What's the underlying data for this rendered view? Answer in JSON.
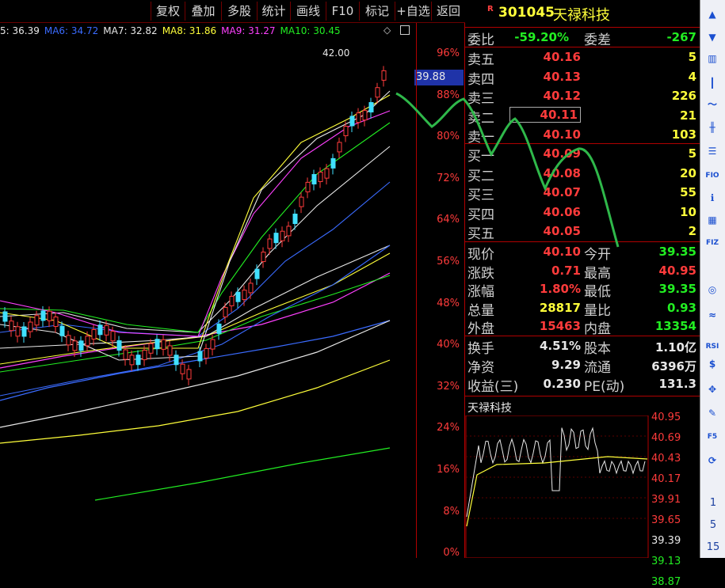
{
  "toolbar": {
    "buttons": [
      "复权",
      "叠加",
      "多股",
      "统计",
      "画线",
      "F10",
      "标记",
      "+自选",
      "返回"
    ]
  },
  "ma_legend": [
    {
      "label": "5: 36.39",
      "color": "#e8e8e8"
    },
    {
      "label": "MA6: 34.72",
      "color": "#3a6bff"
    },
    {
      "label": "MA7: 32.82",
      "color": "#e8e8e8"
    },
    {
      "label": "MA8: 31.86",
      "color": "#ffff3a"
    },
    {
      "label": "MA9: 31.27",
      "color": "#ff40ff"
    },
    {
      "label": "MA10: 30.45",
      "color": "#22ee22"
    }
  ],
  "main_chart": {
    "price_label": "39.88",
    "high_label": "42.00",
    "pct_axis": [
      "96%",
      "88%",
      "80%",
      "72%",
      "64%",
      "56%",
      "48%",
      "40%",
      "32%",
      "24%",
      "16%",
      "8%",
      "0%"
    ]
  },
  "quote": {
    "code": "301045",
    "name": "天禄科技",
    "r_marker": "R",
    "webi_label": "委比",
    "webi_value": "-59.20%",
    "wecha_label": "委差",
    "wecha_value": "-267",
    "asks": [
      {
        "label": "卖五",
        "price": "40.16",
        "vol": "5"
      },
      {
        "label": "卖四",
        "price": "40.13",
        "vol": "4"
      },
      {
        "label": "卖三",
        "price": "40.12",
        "vol": "226"
      },
      {
        "label": "卖二",
        "price": "40.11",
        "vol": "21"
      },
      {
        "label": "卖一",
        "price": "40.10",
        "vol": "103"
      }
    ],
    "bids": [
      {
        "label": "买一",
        "price": "40.09",
        "vol": "5"
      },
      {
        "label": "买二",
        "price": "40.08",
        "vol": "20"
      },
      {
        "label": "买三",
        "price": "40.07",
        "vol": "55"
      },
      {
        "label": "买四",
        "price": "40.06",
        "vol": "10"
      },
      {
        "label": "买五",
        "price": "40.05",
        "vol": "2"
      }
    ],
    "stats": [
      {
        "l1": "现价",
        "v1": "40.10",
        "c1": "red",
        "l2": "今开",
        "v2": "39.35",
        "c2": "green"
      },
      {
        "l1": "涨跌",
        "v1": "0.71",
        "c1": "red",
        "l2": "最高",
        "v2": "40.95",
        "c2": "red"
      },
      {
        "l1": "涨幅",
        "v1": "1.80%",
        "c1": "red",
        "l2": "最低",
        "v2": "39.35",
        "c2": "green"
      },
      {
        "l1": "总量",
        "v1": "28817",
        "c1": "yellow",
        "l2": "量比",
        "v2": "0.93",
        "c2": "green"
      },
      {
        "l1": "外盘",
        "v1": "15463",
        "c1": "red",
        "l2": "内盘",
        "v2": "13354",
        "c2": "green"
      }
    ],
    "fundamentals": [
      {
        "l1": "换手",
        "v1": "4.51%",
        "l2": "股本",
        "v2": "1.10亿"
      },
      {
        "l1": "净资",
        "v1": "9.29",
        "l2": "流通",
        "v2": "6396万"
      },
      {
        "l1": "收益(三)",
        "v1": "0.230",
        "l2": "PE(动)",
        "v2": "131.3"
      }
    ]
  },
  "mini_chart": {
    "title": "天禄科技",
    "ticks": [
      {
        "v": "40.95",
        "c": "red"
      },
      {
        "v": "40.69",
        "c": "red"
      },
      {
        "v": "40.43",
        "c": "red"
      },
      {
        "v": "40.17",
        "c": "red"
      },
      {
        "v": "39.91",
        "c": "red"
      },
      {
        "v": "39.65",
        "c": "red"
      },
      {
        "v": "39.39",
        "c": "white"
      },
      {
        "v": "39.13",
        "c": "green"
      },
      {
        "v": "38.87",
        "c": "green"
      }
    ]
  },
  "sidebar": {
    "icons": [
      "up-arrow-icon",
      "down-arrow-icon",
      "bar-chart-icon",
      "candle-icon",
      "line-chart-icon",
      "kline-icon",
      "list-icon",
      "f10-icon",
      "info-icon",
      "grid-icon",
      "f1-icon",
      "f2-icon",
      "circle-icon",
      "wave-icon",
      "rsi-icon",
      "s-icon",
      "move-icon",
      "pen-icon",
      "f5-icon",
      "refresh-icon"
    ],
    "rsi_label": "RSI",
    "f5_label": "F5",
    "fi_label": "FIO",
    "fz_label": "FIZ",
    "nums": [
      "1",
      "5",
      "15"
    ]
  }
}
